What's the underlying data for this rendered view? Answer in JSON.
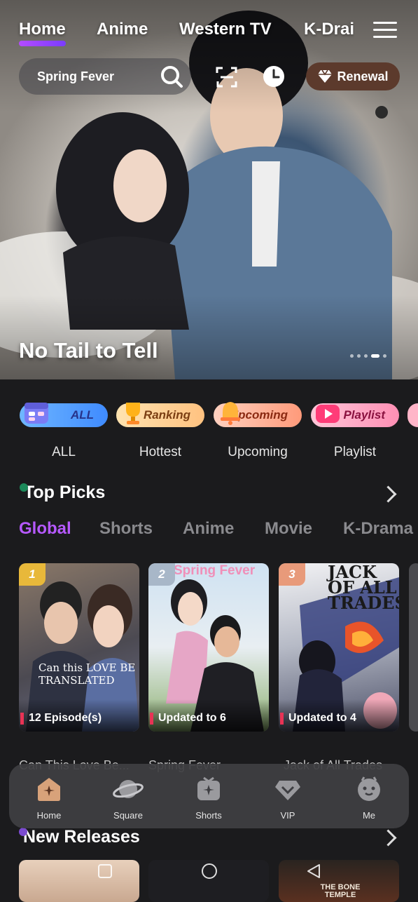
{
  "top_nav": {
    "tabs": [
      {
        "label": "Home",
        "active": true
      },
      {
        "label": "Anime",
        "active": false
      },
      {
        "label": "Western TV",
        "active": false
      },
      {
        "label": "K-Drai",
        "active": false
      }
    ],
    "menu_icon": "hamburger-menu-icon"
  },
  "search": {
    "text": "Spring Fever",
    "icon": "search-icon"
  },
  "header_icons": {
    "scan": "scan-icon",
    "history": "clock-icon"
  },
  "renewal": {
    "label": "Renewal",
    "icon": "diamond-icon"
  },
  "hero": {
    "title": "No Tail to Tell",
    "slide_count": 5,
    "active_slide": 3
  },
  "categories": [
    {
      "pill": "ALL",
      "label": "ALL",
      "icon": "calendar-icon"
    },
    {
      "pill": "Ranking",
      "label": "Hottest",
      "icon": "trophy-icon"
    },
    {
      "pill": "Upcoming",
      "label": "Upcoming",
      "icon": "bell-icon"
    },
    {
      "pill": "Playlist",
      "label": "Playlist",
      "icon": "play-icon"
    }
  ],
  "top_picks": {
    "title": "Top Picks",
    "tabs": [
      {
        "label": "Global",
        "active": true
      },
      {
        "label": "Shorts",
        "active": false
      },
      {
        "label": "Anime",
        "active": false
      },
      {
        "label": "Movie",
        "active": false
      },
      {
        "label": "K-Drama",
        "active": false
      }
    ],
    "cards": [
      {
        "rank": "1",
        "status": "12 Episode(s)",
        "title": "Can This Love Be...",
        "poster_text": "Can this LOVE BE TRANSLATED"
      },
      {
        "rank": "2",
        "status": "Updated to 6",
        "title": "Spring Fever",
        "poster_text": "Spring Fever"
      },
      {
        "rank": "3",
        "status": "Updated to 4",
        "title": "Jack of All Trades",
        "poster_text": "JACK OF ALL TRADES"
      }
    ]
  },
  "bottom_nav": [
    {
      "label": "Home",
      "icon": "home-icon",
      "active": true
    },
    {
      "label": "Square",
      "icon": "planet-icon",
      "active": false
    },
    {
      "label": "Shorts",
      "icon": "shorts-play-icon",
      "active": false
    },
    {
      "label": "VIP",
      "icon": "vip-diamond-icon",
      "active": false
    },
    {
      "label": "Me",
      "icon": "profile-face-icon",
      "active": false
    }
  ],
  "new_releases": {
    "title": "New Releases",
    "thumb_text": "THE BONE TEMPLE"
  },
  "system_nav": {
    "icons": [
      "recent-apps-icon",
      "home-circle-icon",
      "back-triangle-icon"
    ]
  }
}
